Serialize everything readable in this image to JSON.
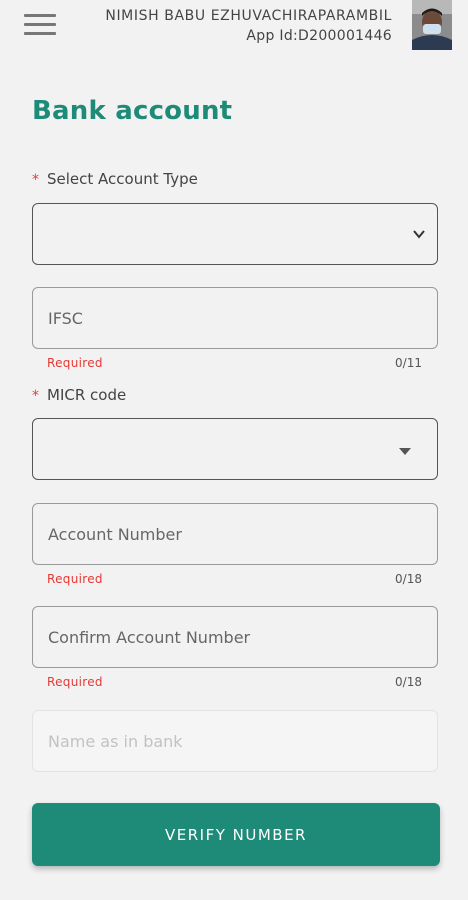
{
  "header": {
    "user_name": "NIMISH BABU EZHUVACHIRAPARAMBIL",
    "app_id": "App Id:D200001446"
  },
  "page": {
    "title": "Bank account"
  },
  "form": {
    "account_type": {
      "label": "Select Account Type",
      "required_mark": "*",
      "value": ""
    },
    "ifsc": {
      "placeholder": "IFSC",
      "value": "",
      "error": "Required",
      "counter": "0/11"
    },
    "micr": {
      "label": "MICR code",
      "required_mark": "*",
      "value": ""
    },
    "account_number": {
      "placeholder": "Account Number",
      "value": "",
      "error": "Required",
      "counter": "0/18"
    },
    "confirm_account_number": {
      "placeholder": "Confirm Account Number",
      "value": "",
      "error": "Required",
      "counter": "0/18"
    },
    "name_in_bank": {
      "placeholder": "Name as in bank",
      "value": ""
    }
  },
  "actions": {
    "verify_label": "VERIFY NUMBER"
  },
  "icons": {
    "menu": "hamburger-icon",
    "account_type_dropdown": "chevron-down-icon",
    "micr_dropdown": "caret-down-icon"
  },
  "colors": {
    "accent": "#1e8a78",
    "error": "#e53935",
    "background": "#f2f2f2"
  }
}
